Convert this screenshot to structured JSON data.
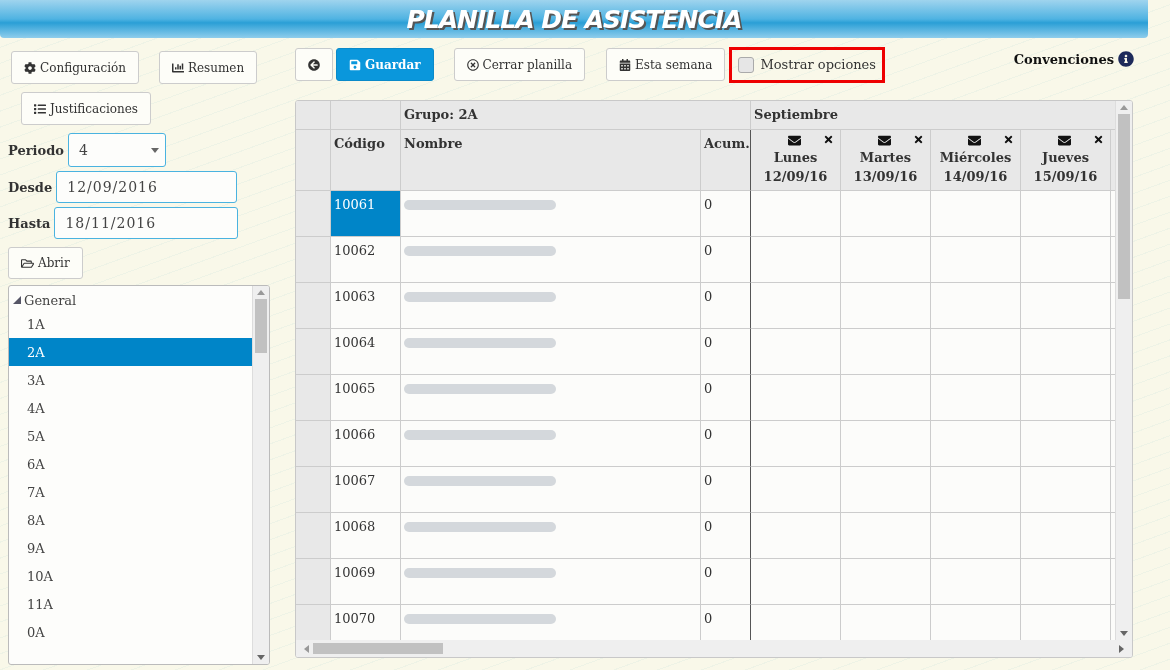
{
  "header": {
    "title": "PLANILLA DE ASISTENCIA"
  },
  "sidebar": {
    "buttons": [
      {
        "kind": "gear",
        "label": "Configuración"
      },
      {
        "kind": "chart",
        "label": "Resumen"
      },
      {
        "kind": "list",
        "label": "Justificaciones"
      }
    ],
    "periodo": {
      "label": "Periodo",
      "value": "4"
    },
    "desde": {
      "label": "Desde",
      "value": "12/09/2016"
    },
    "hasta": {
      "label": "Hasta",
      "value": "18/11/2016"
    },
    "open_button": "Abrir",
    "tree": [
      {
        "label": "General",
        "expanded": true,
        "children": [
          {
            "label": "1A",
            "selected": false
          },
          {
            "label": "2A",
            "selected": true
          },
          {
            "label": "3A",
            "selected": false
          },
          {
            "label": "4A",
            "selected": false
          },
          {
            "label": "5A",
            "selected": false
          },
          {
            "label": "6A",
            "selected": false
          },
          {
            "label": "7A",
            "selected": false
          },
          {
            "label": "8A",
            "selected": false
          },
          {
            "label": "9A",
            "selected": false
          },
          {
            "label": "10A",
            "selected": false
          },
          {
            "label": "11A",
            "selected": false
          },
          {
            "label": "0A",
            "selected": false
          }
        ]
      }
    ]
  },
  "toolbar": {
    "buttons": [
      {
        "kind": "back",
        "primary": false
      },
      {
        "kind": "save",
        "label": "Guardar",
        "primary": true
      },
      {
        "kind": "close",
        "label": "Cerrar planilla",
        "primary": false
      },
      {
        "kind": "calendar",
        "label": "Esta semana",
        "primary": false
      }
    ],
    "show_options": {
      "label": "Mostrar opciones",
      "checked": false,
      "highlighted": true
    },
    "conventions": "Convenciones"
  },
  "table": {
    "group": "Grupo: 2A",
    "month": "Septiembre",
    "columns": [
      "Código",
      "Nombre",
      "Acum."
    ],
    "days": [
      {
        "name": "Lunes",
        "date": "12/09/16"
      },
      {
        "name": "Martes",
        "date": "13/09/16"
      },
      {
        "name": "Miércoles",
        "date": "14/09/16"
      },
      {
        "name": "Jueves",
        "date": "15/09/16"
      }
    ],
    "rows": [
      {
        "code": "10061",
        "acum": "0",
        "selected": true
      },
      {
        "code": "10062",
        "acum": "0",
        "selected": false
      },
      {
        "code": "10063",
        "acum": "0",
        "selected": false
      },
      {
        "code": "10064",
        "acum": "0",
        "selected": false
      },
      {
        "code": "10065",
        "acum": "0",
        "selected": false
      },
      {
        "code": "10066",
        "acum": "0",
        "selected": false
      },
      {
        "code": "10067",
        "acum": "0",
        "selected": false
      },
      {
        "code": "10068",
        "acum": "0",
        "selected": false
      },
      {
        "code": "10069",
        "acum": "0",
        "selected": false
      },
      {
        "code": "10070",
        "acum": "0",
        "selected": false
      }
    ]
  }
}
